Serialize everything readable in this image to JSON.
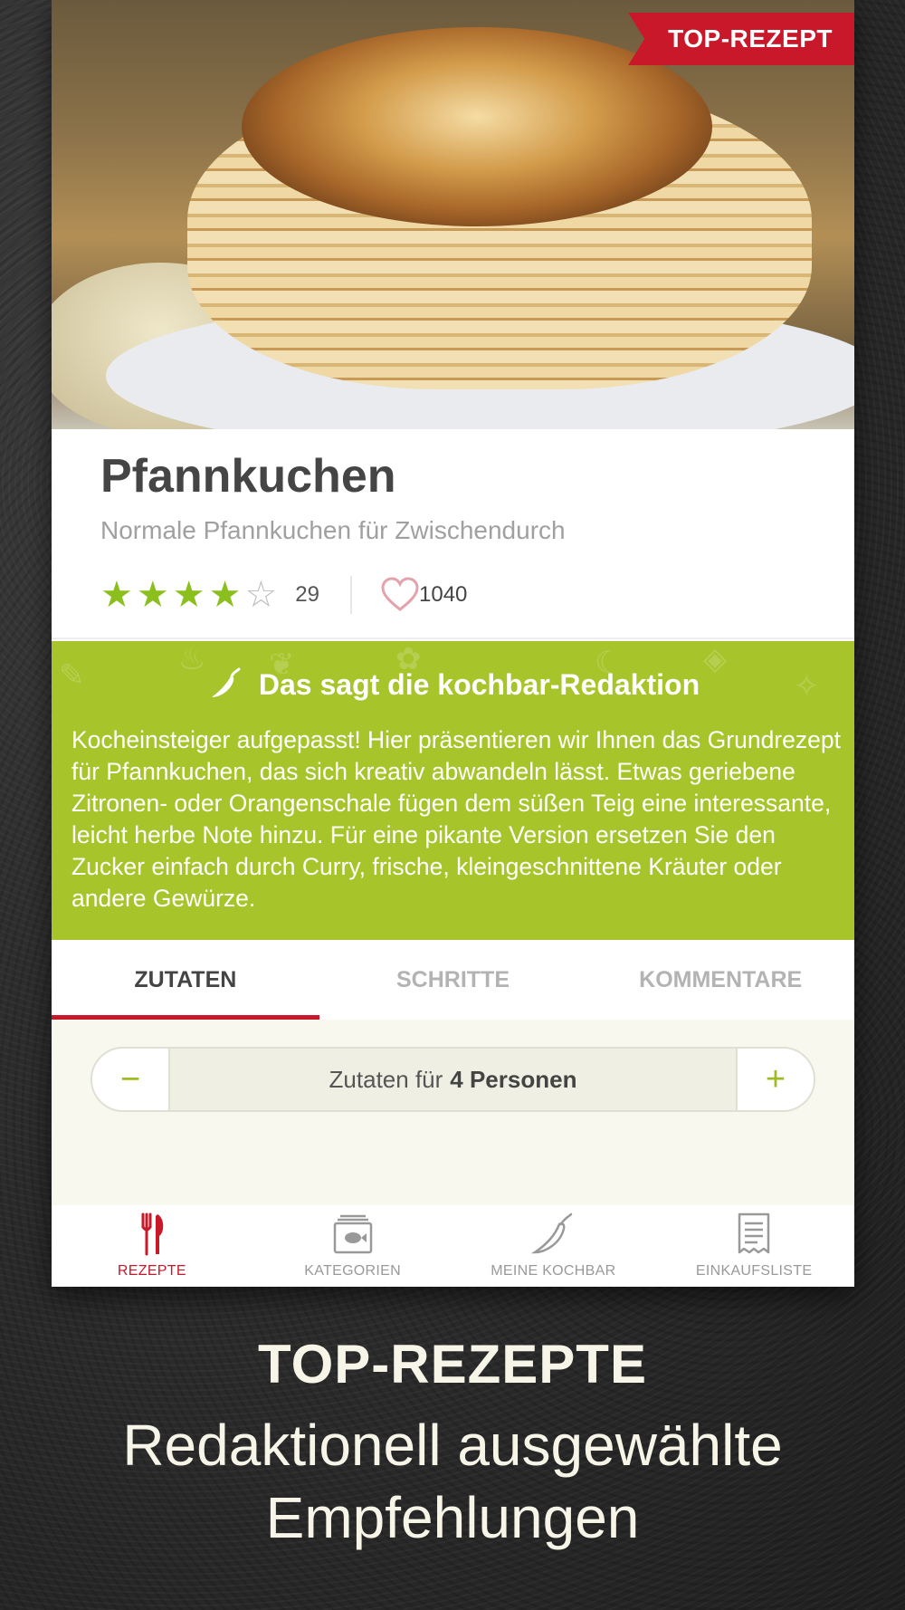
{
  "hero": {
    "image_alt": "Stack of pancakes on a plate",
    "badge": "TOP-REZEPT",
    "badge_color": "#c8182a"
  },
  "recipe": {
    "title": "Pfannkuchen",
    "subtitle": "Normale Pfannkuchen für Zwischendurch",
    "rating_stars": 4,
    "rating_max": 5,
    "rating_count": "29",
    "likes": "1040"
  },
  "editorial": {
    "heading": "Das sagt die kochbar-Redaktion",
    "icon": "chili-icon",
    "text": "Kocheinsteiger aufgepasst!  Hier präsentieren wir Ihnen das Grundrezept für Pfannkuchen, das sich kreativ abwandeln lässt.  Etwas geriebene Zitronen- oder Orangenschale fügen dem süßen Teig eine interessante, leicht herbe Note hinzu.  Für eine pikante Version ersetzen Sie den Zucker einfach durch Curry, frische, kleingeschnittene Kräuter oder andere Gewürze.",
    "background": "#a7c52a"
  },
  "tabs": [
    {
      "label": "ZUTATEN",
      "active": true
    },
    {
      "label": "SCHRITTE",
      "active": false
    },
    {
      "label": "KOMMENTARE",
      "active": false
    }
  ],
  "ingredients": {
    "minus": "−",
    "plus": "+",
    "label_prefix": "Zutaten für",
    "persons": "4 Personen"
  },
  "bottom_nav": [
    {
      "label": "REZEPTE",
      "icon": "fork-knife-icon",
      "active": true
    },
    {
      "label": "KATEGORIEN",
      "icon": "category-box-icon",
      "active": false
    },
    {
      "label": "MEINE KOCHBAR",
      "icon": "chili-outline-icon",
      "active": false
    },
    {
      "label": "EINKAUFSLISTE",
      "icon": "receipt-icon",
      "active": false
    }
  ],
  "promo": {
    "title": "TOP-REZEPTE",
    "line1": "Redaktionell ausgewählte",
    "line2": "Empfehlungen"
  },
  "colors": {
    "accent_red": "#c8182a",
    "accent_green": "#8bbf1d",
    "promo_text": "#f7f4e8"
  }
}
